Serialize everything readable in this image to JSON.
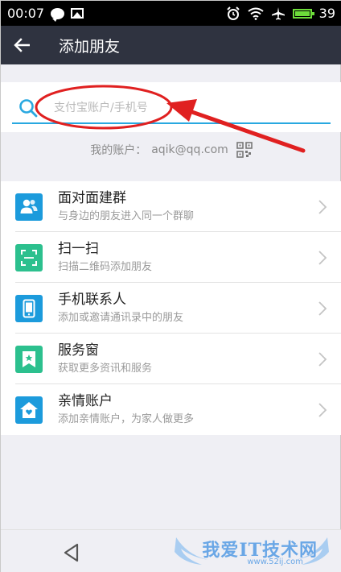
{
  "status_bar": {
    "time": "00:07",
    "battery": "39"
  },
  "header": {
    "title": "添加朋友"
  },
  "search": {
    "placeholder": "支付宝账户/手机号"
  },
  "account": {
    "label": "我的账户：",
    "value": "aqik@qq.com"
  },
  "list": [
    {
      "title": "面对面建群",
      "subtitle": "与身边的朋友进入同一个群聊",
      "icon": "group-icon",
      "color": "#1c9bdc"
    },
    {
      "title": "扫一扫",
      "subtitle": "扫描二维码添加朋友",
      "icon": "scan-icon",
      "color": "#2cc08e"
    },
    {
      "title": "手机联系人",
      "subtitle": "添加或邀请通讯录中的朋友",
      "icon": "phone-icon",
      "color": "#1c9bdc"
    },
    {
      "title": "服务窗",
      "subtitle": "获取更多资讯和服务",
      "icon": "service-window-icon",
      "color": "#2cc08e"
    },
    {
      "title": "亲情账户",
      "subtitle": "添加亲情账户，为家人做更多",
      "icon": "family-account-icon",
      "color": "#1c9bdc"
    }
  ],
  "watermark": {
    "text": "我爱IT技术网",
    "url": "www.52ij.com"
  },
  "colors": {
    "header_bg": "#2f3340",
    "accent": "#29a8e0",
    "annotation_red": "#e02020"
  }
}
